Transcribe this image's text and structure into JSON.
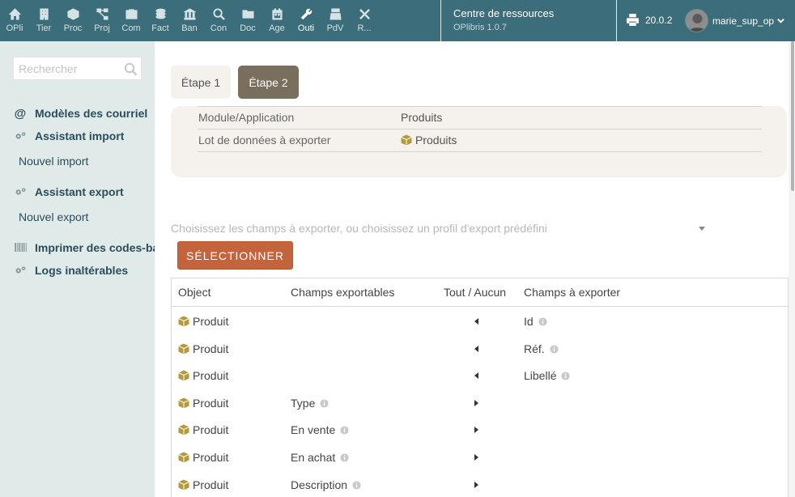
{
  "topmenu": [
    {
      "label": "OPli",
      "icon": "home-icon"
    },
    {
      "label": "Tier",
      "icon": "building-icon"
    },
    {
      "label": "Proc",
      "icon": "cube-icon"
    },
    {
      "label": "Proj",
      "icon": "sitemap-icon"
    },
    {
      "label": "Com",
      "icon": "briefcase-icon"
    },
    {
      "label": "Fact",
      "icon": "coins-icon"
    },
    {
      "label": "Ban",
      "icon": "bank-icon"
    },
    {
      "label": "Con",
      "icon": "search-dollar-icon"
    },
    {
      "label": "Doc",
      "icon": "folder-icon"
    },
    {
      "label": "Age",
      "icon": "calendar-icon"
    },
    {
      "label": "Outi",
      "icon": "wrench-icon",
      "active": true
    },
    {
      "label": "PdV",
      "icon": "cash-register-icon"
    },
    {
      "label": "R...",
      "icon": "tools-icon"
    }
  ],
  "header": {
    "resource_title": "Centre de ressources",
    "resource_subtitle": "OPlibris 1.0.7",
    "version": "20.0.2",
    "username": "marie_sup_op"
  },
  "sidebar": {
    "search_placeholder": "Rechercher",
    "items": [
      {
        "label": "Modèles des courriel",
        "type": "title",
        "icon": "at-icon"
      },
      {
        "label": "Assistant import",
        "type": "title",
        "icon": "cogs-icon"
      },
      {
        "label": "Nouvel import",
        "type": "sub"
      },
      {
        "label": "Assistant export",
        "type": "title",
        "icon": "cogs-icon"
      },
      {
        "label": "Nouvel export",
        "type": "sub"
      },
      {
        "label": "Imprimer des codes-barres",
        "type": "title",
        "icon": "barcode-icon"
      },
      {
        "label": "Logs inaltérables",
        "type": "title",
        "icon": "cogs-icon"
      }
    ]
  },
  "steps": {
    "step1": "Étape 1",
    "step2": "Étape 2"
  },
  "summary": {
    "rows": [
      {
        "key": "Module/Application",
        "value": "Produits"
      },
      {
        "key": "Lot de données à exporter",
        "value": "Produits"
      }
    ]
  },
  "profile_placeholder": "Choisissez les champs à exporter, ou choisissez un profil d'export prédéfini",
  "select_button": "SÉLECTIONNER",
  "table": {
    "headers": {
      "object": "Object",
      "fields": "Champs exportables",
      "toggle": "Tout / Aucun",
      "export": "Champs à exporter"
    },
    "rows": [
      {
        "object": "Produit",
        "field": "",
        "arrow": "left",
        "export": "Id"
      },
      {
        "object": "Produit",
        "field": "",
        "arrow": "left",
        "export": "Réf."
      },
      {
        "object": "Produit",
        "field": "",
        "arrow": "left",
        "export": "Libellé"
      },
      {
        "object": "Produit",
        "field": "Type",
        "arrow": "right",
        "export": ""
      },
      {
        "object": "Produit",
        "field": "En vente",
        "arrow": "right",
        "export": ""
      },
      {
        "object": "Produit",
        "field": "En achat",
        "arrow": "right",
        "export": ""
      },
      {
        "object": "Produit",
        "field": "Description",
        "arrow": "right",
        "export": ""
      }
    ]
  },
  "colors": {
    "topbar": "#3c6d7a",
    "sidebar": "#e0eae8",
    "accent_button": "#c4643d",
    "step_active": "#7a6e5d",
    "product_icon": "#b59a3c"
  }
}
